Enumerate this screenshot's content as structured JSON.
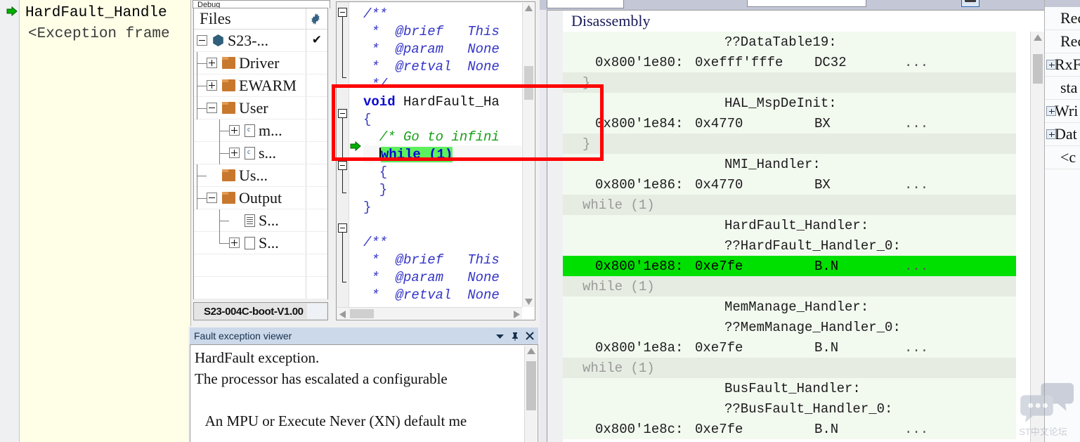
{
  "callstack": {
    "lines": [
      {
        "text": "HardFault_Handle",
        "arrow": true
      },
      {
        "text": "<Exception frame",
        "arrow": false
      }
    ]
  },
  "workspace": {
    "tab_label": "Debug",
    "header_title": "Files",
    "gear_icon": "gear-icon",
    "check_icon": "check-icon",
    "footer_label": "S23-004C-boot-V1.00",
    "tree": [
      {
        "label": "S23-...",
        "icon": "project-icon",
        "expander": "minus",
        "depth": 0,
        "checked": true
      },
      {
        "label": "Driver",
        "icon": "folder-icon",
        "expander": "plus",
        "depth": 1
      },
      {
        "label": "EWARM",
        "icon": "folder-icon",
        "expander": "plus",
        "depth": 1
      },
      {
        "label": "User",
        "icon": "folder-icon",
        "expander": "minus",
        "depth": 1
      },
      {
        "label": "m...",
        "icon": "c-file-icon",
        "expander": "plus",
        "depth": 2
      },
      {
        "label": "s...",
        "icon": "c-file-icon",
        "expander": "plus",
        "depth": 2
      },
      {
        "label": "Us...",
        "icon": "folder-icon",
        "expander": "none",
        "depth": 1
      },
      {
        "label": "Output",
        "icon": "folder-icon",
        "expander": "minus",
        "depth": 1
      },
      {
        "label": "S...",
        "icon": "doc-icon",
        "expander": "none",
        "depth": 2
      },
      {
        "label": "S...",
        "icon": "page-icon",
        "expander": "plus",
        "depth": 2
      }
    ]
  },
  "editor": {
    "lines": [
      {
        "id": "l1",
        "text": "/**",
        "style": "cmt-blue"
      },
      {
        "id": "l2",
        "text": " *  @brief   This",
        "style": "cmt-blue"
      },
      {
        "id": "l3",
        "text": " *  @param   None",
        "style": "cmt-blue"
      },
      {
        "id": "l4",
        "text": " *  @retval  None",
        "style": "cmt-blue"
      },
      {
        "id": "l5",
        "text": " */",
        "style": "cmt-blue"
      },
      {
        "id": "l6",
        "text": "void HardFault_Ha",
        "style": "decl"
      },
      {
        "id": "l7",
        "text": "{",
        "style": "brace"
      },
      {
        "id": "l8",
        "text": "  /* Go to infini",
        "style": "cmt-green"
      },
      {
        "id": "l9",
        "text": "while (1)",
        "style": "highlight-current"
      },
      {
        "id": "l10",
        "text": "  {",
        "style": "brace"
      },
      {
        "id": "l11",
        "text": "  }",
        "style": "brace"
      },
      {
        "id": "l12",
        "text": "}",
        "style": "brace"
      },
      {
        "id": "l13",
        "text": "",
        "style": "blank"
      },
      {
        "id": "l14",
        "text": "/**",
        "style": "cmt-blue"
      },
      {
        "id": "l15",
        "text": " *  @brief   This",
        "style": "cmt-blue"
      },
      {
        "id": "l16",
        "text": " *  @param   None",
        "style": "cmt-blue"
      },
      {
        "id": "l17",
        "text": " *  @retval  None",
        "style": "cmt-blue"
      },
      {
        "id": "l18",
        "text": " */",
        "style": "cmt-blue"
      }
    ],
    "decl_keyword": "void",
    "decl_rest": " HardFault_Ha",
    "while_text": "while (1)",
    "current_line_arrow_icon": "execution-pointer-icon"
  },
  "disassembly": {
    "header": "Disassembly",
    "rows": [
      {
        "kind": "label",
        "text": "??DataTable19:"
      },
      {
        "kind": "code",
        "addr": "0x800'1e80:",
        "opcode": "0xefff'fffe",
        "mnemonic": "DC32",
        "operand": "..."
      },
      {
        "kind": "src",
        "text": "}"
      },
      {
        "kind": "label",
        "text": "HAL_MspDeInit:"
      },
      {
        "kind": "code",
        "addr": "0x800'1e84:",
        "opcode": "0x4770",
        "mnemonic": "BX",
        "operand": "..."
      },
      {
        "kind": "src",
        "text": "}"
      },
      {
        "kind": "label",
        "text": "NMI_Handler:"
      },
      {
        "kind": "code",
        "addr": "0x800'1e86:",
        "opcode": "0x4770",
        "mnemonic": "BX",
        "operand": "..."
      },
      {
        "kind": "src",
        "text": "while (1)"
      },
      {
        "kind": "label",
        "text": "HardFault_Handler:"
      },
      {
        "kind": "label",
        "text": "??HardFault_Handler_0:"
      },
      {
        "kind": "code",
        "addr": "0x800'1e88:",
        "opcode": "0xe7fe",
        "mnemonic": "B.N",
        "operand": "...",
        "highlight": true
      },
      {
        "kind": "src",
        "text": "while (1)"
      },
      {
        "kind": "label",
        "text": "MemManage_Handler:"
      },
      {
        "kind": "label",
        "text": "??MemManage_Handler_0:"
      },
      {
        "kind": "code",
        "addr": "0x800'1e8a:",
        "opcode": "0xe7fe",
        "mnemonic": "B.N",
        "operand": "..."
      },
      {
        "kind": "src",
        "text": "while (1)"
      },
      {
        "kind": "label",
        "text": "BusFault_Handler:"
      },
      {
        "kind": "label",
        "text": "??BusFault_Handler_0:"
      },
      {
        "kind": "code",
        "addr": "0x800'1e8c:",
        "opcode": "0xe7fe",
        "mnemonic": "B.N",
        "operand": "..."
      }
    ],
    "highlight_color": "#00e000"
  },
  "right_sidebar": {
    "rows": [
      {
        "label": "Rec",
        "expander": false
      },
      {
        "label": "Rec",
        "expander": false
      },
      {
        "label": "RxF",
        "expander": true
      },
      {
        "label": "sta",
        "expander": false
      },
      {
        "label": "Wri",
        "expander": true
      },
      {
        "label": "Dat",
        "expander": true
      },
      {
        "label": "<c",
        "expander": false
      }
    ]
  },
  "fault_viewer": {
    "title": "Fault exception viewer",
    "tools": {
      "dropdown_icon": "chevron-down-icon",
      "pin_icon": "pin-icon",
      "close_icon": "close-icon"
    },
    "lines": [
      "HardFault exception.",
      "The processor has escalated a configurable",
      "",
      "   An MPU or Execute Never (XN) default me"
    ]
  },
  "annotation": {
    "type": "rectangle",
    "color": "#ff0000"
  },
  "watermark": {
    "text": "ST中文论坛",
    "icon": "chat-bubbles-icon"
  }
}
